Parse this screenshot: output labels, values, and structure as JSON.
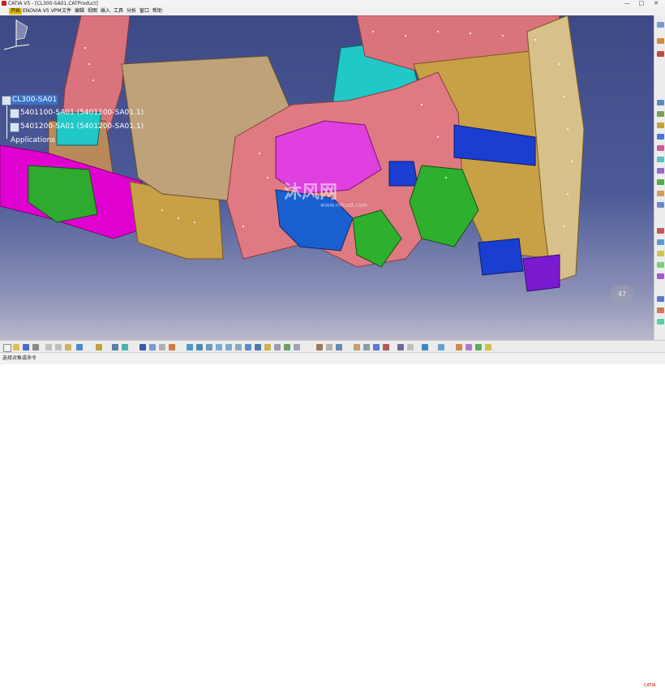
{
  "window": {
    "title": "CATIA V5 - [CL300-SA01.CATProduct]"
  },
  "menu": {
    "start": "开始",
    "items": [
      "ENOVIA V5 VPM",
      "文件",
      "编辑",
      "视图",
      "插入",
      "工具",
      "分析",
      "窗口",
      "帮助"
    ]
  },
  "tree": {
    "root": "CL300-SA01",
    "children": [
      "5401100-SA01 (5401100-SA01.1)",
      "5401200-SA01 (5401200-SA01.1)"
    ],
    "applications": "Applications"
  },
  "viewport": {
    "watermark_brand": "沐风网",
    "watermark_url": "www.mfcad.com",
    "mini_compass_value": "47"
  },
  "status": {
    "message": "选择对象或命令"
  },
  "logo": "CATIA",
  "colors": {
    "background_top": "#3e4a86",
    "selection": "#3a72c8",
    "part_pink": "#e0737b",
    "part_magenta": "#e000d0",
    "part_gold": "#c8a046",
    "part_blue": "#1a3fd0",
    "part_green": "#2eb02e",
    "part_cyan": "#20c8c8"
  }
}
